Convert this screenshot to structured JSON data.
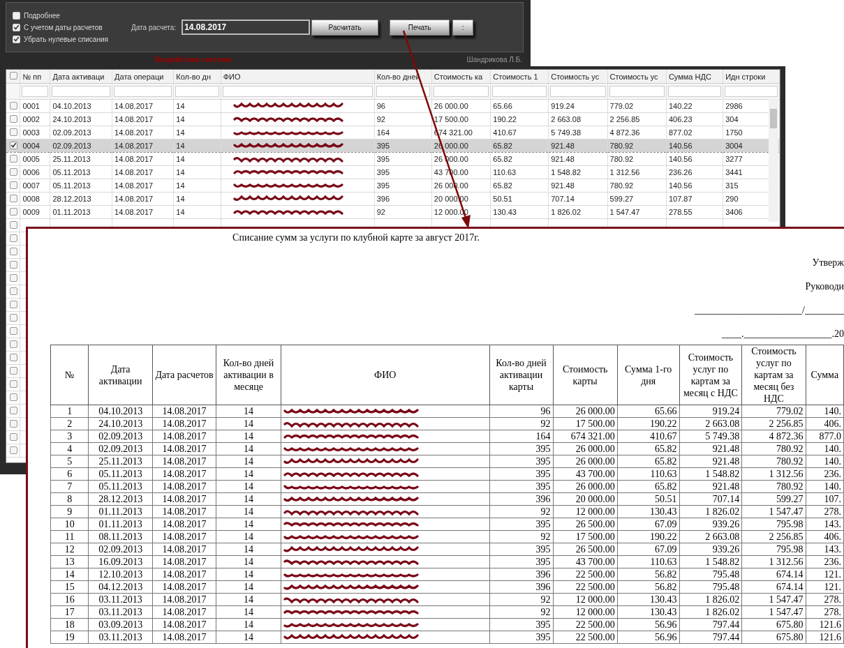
{
  "toolbar": {
    "options": [
      {
        "label": "Подробнее",
        "checked": false
      },
      {
        "label": "С учетом даты расчетов",
        "checked": true
      },
      {
        "label": "Убрать нулевые списания",
        "checked": true
      }
    ],
    "date_label": "Дата расчета:",
    "date_value": "14.08.2017",
    "buttons": [
      "Расчитать",
      "Печать",
      ":"
    ]
  },
  "status": {
    "message": "Бездействие системы",
    "user": "Шандрикова Л.Б."
  },
  "grid": {
    "select_all_checked": false,
    "columns": [
      {
        "label": "№ пп",
        "kind": "text"
      },
      {
        "label": "Дата активаци",
        "kind": "text"
      },
      {
        "label": "Дата операци",
        "kind": "text"
      },
      {
        "label": "Кол-во дн",
        "kind": "text"
      },
      {
        "label": "ФИО",
        "kind": "name"
      },
      {
        "label": "Кол-во дней",
        "kind": "text"
      },
      {
        "label": "Стоимость ка",
        "kind": "text"
      },
      {
        "label": "Стоимость 1",
        "kind": "text"
      },
      {
        "label": "Стоимость ус",
        "kind": "text"
      },
      {
        "label": "Стоимость ус",
        "kind": "text"
      },
      {
        "label": "Сумма НДС",
        "kind": "text"
      },
      {
        "label": "Идн строки",
        "kind": "text"
      }
    ],
    "rows": [
      {
        "checked": false,
        "selected": false,
        "name_redacted": true,
        "values": [
          "0001",
          "04.10.2013",
          "14.08.2017",
          "14",
          "96",
          "26 000.00",
          "65.66",
          "919.24",
          "779.02",
          "140.22",
          "2986"
        ]
      },
      {
        "checked": false,
        "selected": false,
        "name_redacted": true,
        "values": [
          "0002",
          "24.10.2013",
          "14.08.2017",
          "14",
          "92",
          "17 500.00",
          "190.22",
          "2 663.08",
          "2 256.85",
          "406.23",
          "304"
        ]
      },
      {
        "checked": false,
        "selected": false,
        "name_redacted": true,
        "values": [
          "0003",
          "02.09.2013",
          "14.08.2017",
          "14",
          "164",
          "674 321.00",
          "410.67",
          "5 749.38",
          "4 872.36",
          "877.02",
          "1750"
        ]
      },
      {
        "checked": true,
        "selected": true,
        "name_redacted": true,
        "values": [
          "0004",
          "02.09.2013",
          "14.08.2017",
          "14",
          "395",
          "26 000.00",
          "65.82",
          "921.48",
          "780.92",
          "140.56",
          "3004"
        ]
      },
      {
        "checked": false,
        "selected": false,
        "name_redacted": true,
        "values": [
          "0005",
          "25.11.2013",
          "14.08.2017",
          "14",
          "395",
          "26 000.00",
          "65.82",
          "921.48",
          "780.92",
          "140.56",
          "3277"
        ]
      },
      {
        "checked": false,
        "selected": false,
        "name_redacted": true,
        "values": [
          "0006",
          "05.11.2013",
          "14.08.2017",
          "14",
          "395",
          "43 700.00",
          "110.63",
          "1 548.82",
          "1 312.56",
          "236.26",
          "3441"
        ]
      },
      {
        "checked": false,
        "selected": false,
        "name_redacted": true,
        "values": [
          "0007",
          "05.11.2013",
          "14.08.2017",
          "14",
          "395",
          "26 000.00",
          "65.82",
          "921.48",
          "780.92",
          "140.56",
          "315"
        ]
      },
      {
        "checked": false,
        "selected": false,
        "name_redacted": true,
        "values": [
          "0008",
          "28.12.2013",
          "14.08.2017",
          "14",
          "396",
          "20 000.00",
          "50.51",
          "707.14",
          "599.27",
          "107.87",
          "290"
        ]
      },
      {
        "checked": false,
        "selected": false,
        "name_redacted": true,
        "values": [
          "0009",
          "01.11.2013",
          "14.08.2017",
          "14",
          "92",
          "12 000.00",
          "130.43",
          "1 826.02",
          "1 547.47",
          "278.55",
          "3406"
        ]
      },
      {
        "checked": false,
        "selected": false
      },
      {
        "checked": false,
        "selected": false
      },
      {
        "checked": false,
        "selected": false
      },
      {
        "checked": false,
        "selected": false
      },
      {
        "checked": false,
        "selected": false
      },
      {
        "checked": false,
        "selected": false
      },
      {
        "checked": false,
        "selected": false
      },
      {
        "checked": false,
        "selected": false
      },
      {
        "checked": false,
        "selected": false
      },
      {
        "checked": false,
        "selected": false
      },
      {
        "checked": false,
        "selected": false
      },
      {
        "checked": false,
        "selected": false
      },
      {
        "checked": false,
        "selected": false
      },
      {
        "checked": false,
        "selected": false
      },
      {
        "checked": false,
        "selected": false
      },
      {
        "checked": false,
        "selected": false
      },
      {
        "checked": false,
        "selected": false
      },
      {
        "checked": false,
        "selected": false
      }
    ]
  },
  "print_preview": {
    "title": "Списание сумм за услуги по клубной карте за август 2017г.",
    "approval": [
      "Утверж",
      "Руководи",
      "______________________/________",
      "____.__________________.20"
    ],
    "columns": [
      {
        "label": "№",
        "kind": "center"
      },
      {
        "label": "Дата активации",
        "kind": "center"
      },
      {
        "label": "Дата расчетов",
        "kind": "center"
      },
      {
        "label": "Кол-во дней активации в месяце",
        "kind": "center"
      },
      {
        "label": "ФИО",
        "kind": "name"
      },
      {
        "label": "Кол-во дней активации карты",
        "kind": "number"
      },
      {
        "label": "Стоимость карты",
        "kind": "number"
      },
      {
        "label": "Сумма 1-го дня",
        "kind": "number"
      },
      {
        "label": "Стоимость услуг по картам за месяц с НДС",
        "kind": "number"
      },
      {
        "label": "Стоимость услуг по картам за месяц без НДС",
        "kind": "number"
      },
      {
        "label": "Сумма",
        "kind": "number"
      }
    ],
    "rows": [
      {
        "name_redacted": true,
        "values": [
          "1",
          "04.10.2013",
          "14.08.2017",
          "14",
          "96",
          "26 000.00",
          "65.66",
          "919.24",
          "779.02",
          "140."
        ]
      },
      {
        "name_redacted": true,
        "values": [
          "2",
          "24.10.2013",
          "14.08.2017",
          "14",
          "92",
          "17 500.00",
          "190.22",
          "2 663.08",
          "2 256.85",
          "406."
        ]
      },
      {
        "name_redacted": true,
        "values": [
          "3",
          "02.09.2013",
          "14.08.2017",
          "14",
          "164",
          "674 321.00",
          "410.67",
          "5 749.38",
          "4 872.36",
          "877.0"
        ]
      },
      {
        "name_redacted": true,
        "values": [
          "4",
          "02.09.2013",
          "14.08.2017",
          "14",
          "395",
          "26 000.00",
          "65.82",
          "921.48",
          "780.92",
          "140."
        ]
      },
      {
        "name_redacted": true,
        "values": [
          "5",
          "25.11.2013",
          "14.08.2017",
          "14",
          "395",
          "26 000.00",
          "65.82",
          "921.48",
          "780.92",
          "140."
        ]
      },
      {
        "name_redacted": true,
        "values": [
          "6",
          "05.11.2013",
          "14.08.2017",
          "14",
          "395",
          "43 700.00",
          "110.63",
          "1 548.82",
          "1 312.56",
          "236."
        ]
      },
      {
        "name_redacted": true,
        "values": [
          "7",
          "05.11.2013",
          "14.08.2017",
          "14",
          "395",
          "26 000.00",
          "65.82",
          "921.48",
          "780.92",
          "140."
        ]
      },
      {
        "name_redacted": true,
        "values": [
          "8",
          "28.12.2013",
          "14.08.2017",
          "14",
          "396",
          "20 000.00",
          "50.51",
          "707.14",
          "599.27",
          "107."
        ]
      },
      {
        "name_redacted": true,
        "values": [
          "9",
          "01.11.2013",
          "14.08.2017",
          "14",
          "92",
          "12 000.00",
          "130.43",
          "1 826.02",
          "1 547.47",
          "278."
        ]
      },
      {
        "name_redacted": true,
        "values": [
          "10",
          "01.11.2013",
          "14.08.2017",
          "14",
          "395",
          "26 500.00",
          "67.09",
          "939.26",
          "795.98",
          "143."
        ]
      },
      {
        "name_redacted": true,
        "values": [
          "11",
          "08.11.2013",
          "14.08.2017",
          "14",
          "92",
          "17 500.00",
          "190.22",
          "2 663.08",
          "2 256.85",
          "406."
        ]
      },
      {
        "name_redacted": true,
        "values": [
          "12",
          "02.09.2013",
          "14.08.2017",
          "14",
          "395",
          "26 500.00",
          "67.09",
          "939.26",
          "795.98",
          "143."
        ]
      },
      {
        "name_redacted": true,
        "values": [
          "13",
          "16.09.2013",
          "14.08.2017",
          "14",
          "395",
          "43 700.00",
          "110.63",
          "1 548.82",
          "1 312.56",
          "236."
        ]
      },
      {
        "name_redacted": true,
        "values": [
          "14",
          "12.10.2013",
          "14.08.2017",
          "14",
          "396",
          "22 500.00",
          "56.82",
          "795.48",
          "674.14",
          "121."
        ]
      },
      {
        "name_redacted": true,
        "values": [
          "15",
          "04.12.2013",
          "14.08.2017",
          "14",
          "396",
          "22 500.00",
          "56.82",
          "795.48",
          "674.14",
          "121."
        ]
      },
      {
        "name_redacted": true,
        "values": [
          "16",
          "03.11.2013",
          "14.08.2017",
          "14",
          "92",
          "12 000.00",
          "130.43",
          "1 826.02",
          "1 547.47",
          "278."
        ]
      },
      {
        "name_redacted": true,
        "values": [
          "17",
          "03.11.2013",
          "14.08.2017",
          "14",
          "92",
          "12 000.00",
          "130.43",
          "1 826.02",
          "1 547.47",
          "278."
        ]
      },
      {
        "name_redacted": true,
        "values": [
          "18",
          "03.09.2013",
          "14.08.2017",
          "14",
          "395",
          "22 500.00",
          "56.96",
          "797.44",
          "675.80",
          "121.6"
        ]
      },
      {
        "name_redacted": true,
        "values": [
          "19",
          "03.11.2013",
          "14.08.2017",
          "14",
          "395",
          "22 500.00",
          "56.96",
          "797.44",
          "675.80",
          "121.6"
        ]
      }
    ]
  }
}
